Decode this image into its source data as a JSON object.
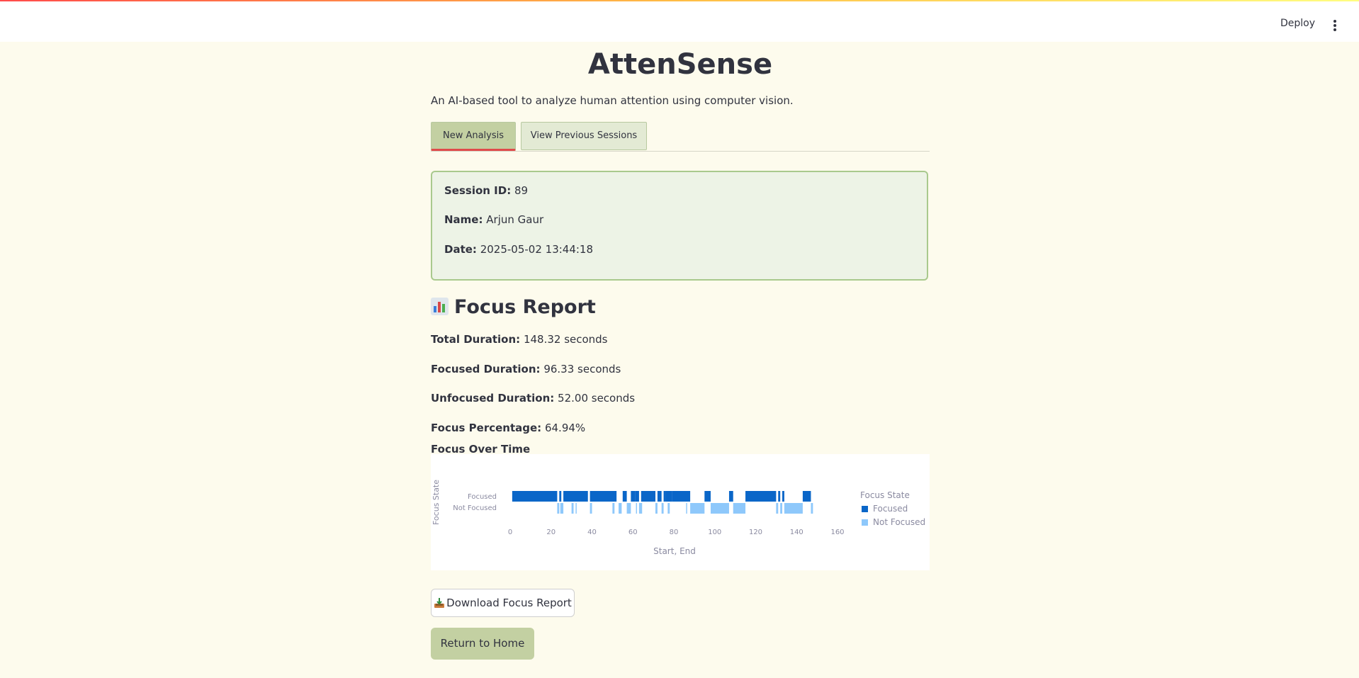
{
  "header": {
    "deploy_label": "Deploy",
    "menu_icon": "vertical-dots-icon"
  },
  "app": {
    "title": "AttenSense",
    "subtitle": "An AI-based tool to analyze human attention using computer vision."
  },
  "tabs": [
    {
      "label": "New Analysis",
      "active": true
    },
    {
      "label": "View Previous Sessions",
      "active": false
    }
  ],
  "session": {
    "id_label": "Session ID:",
    "id_value": "89",
    "name_label": "Name:",
    "name_value": "Arjun Gaur",
    "date_label": "Date:",
    "date_value": "2025-05-02 13:44:18"
  },
  "report": {
    "icon": "bar-chart-icon",
    "title": "Focus Report",
    "total_label": "Total Duration:",
    "total_value": "148.32 seconds",
    "focused_label": "Focused Duration:",
    "focused_value": "96.33 seconds",
    "unfocused_label": "Unfocused Duration:",
    "unfocused_value": "52.00 seconds",
    "percentage_label": "Focus Percentage:",
    "percentage_value": "64.94%"
  },
  "chart_data": {
    "type": "bar",
    "title": "Focus Over Time",
    "xlabel": "Start, End",
    "ylabel": "Focus State",
    "categories": [
      "Focused",
      "Not Focused"
    ],
    "xlim": [
      0,
      160
    ],
    "xticks": [
      0,
      20,
      40,
      60,
      80,
      100,
      120,
      140,
      160
    ],
    "legend": {
      "title": "Focus State",
      "entries": [
        "Focused",
        "Not Focused"
      ],
      "placement": "right"
    },
    "colors": {
      "Focused": "#0a66c8",
      "Not Focused": "#8ec8fb"
    },
    "series": [
      {
        "name": "Focused",
        "intervals": [
          [
            1,
            23
          ],
          [
            24,
            25
          ],
          [
            26,
            38
          ],
          [
            39,
            52
          ],
          [
            55,
            57
          ],
          [
            59,
            61
          ],
          [
            61,
            63
          ],
          [
            64,
            71
          ],
          [
            72,
            74
          ],
          [
            75,
            76
          ],
          [
            76,
            79
          ],
          [
            79,
            88
          ],
          [
            95,
            98
          ],
          [
            107,
            109
          ],
          [
            115,
            130
          ],
          [
            131,
            132
          ],
          [
            133,
            134
          ],
          [
            143,
            147
          ]
        ]
      },
      {
        "name": "Not Focused",
        "intervals": [
          [
            23,
            24
          ],
          [
            24.5,
            26
          ],
          [
            30,
            31
          ],
          [
            32,
            32.5
          ],
          [
            39,
            40
          ],
          [
            50,
            51
          ],
          [
            53,
            54.5
          ],
          [
            57,
            59
          ],
          [
            61.5,
            62
          ],
          [
            63,
            64.5
          ],
          [
            71,
            72
          ],
          [
            74,
            75
          ],
          [
            77,
            78
          ],
          [
            86,
            86.5
          ],
          [
            88,
            95
          ],
          [
            98,
            107
          ],
          [
            109,
            115
          ],
          [
            130,
            131
          ],
          [
            132,
            133
          ],
          [
            134,
            143
          ],
          [
            147,
            148
          ]
        ]
      }
    ]
  },
  "buttons": {
    "download_label": "Download Focus Report",
    "download_icon": "inbox-tray-icon",
    "home_label": "Return to Home"
  }
}
